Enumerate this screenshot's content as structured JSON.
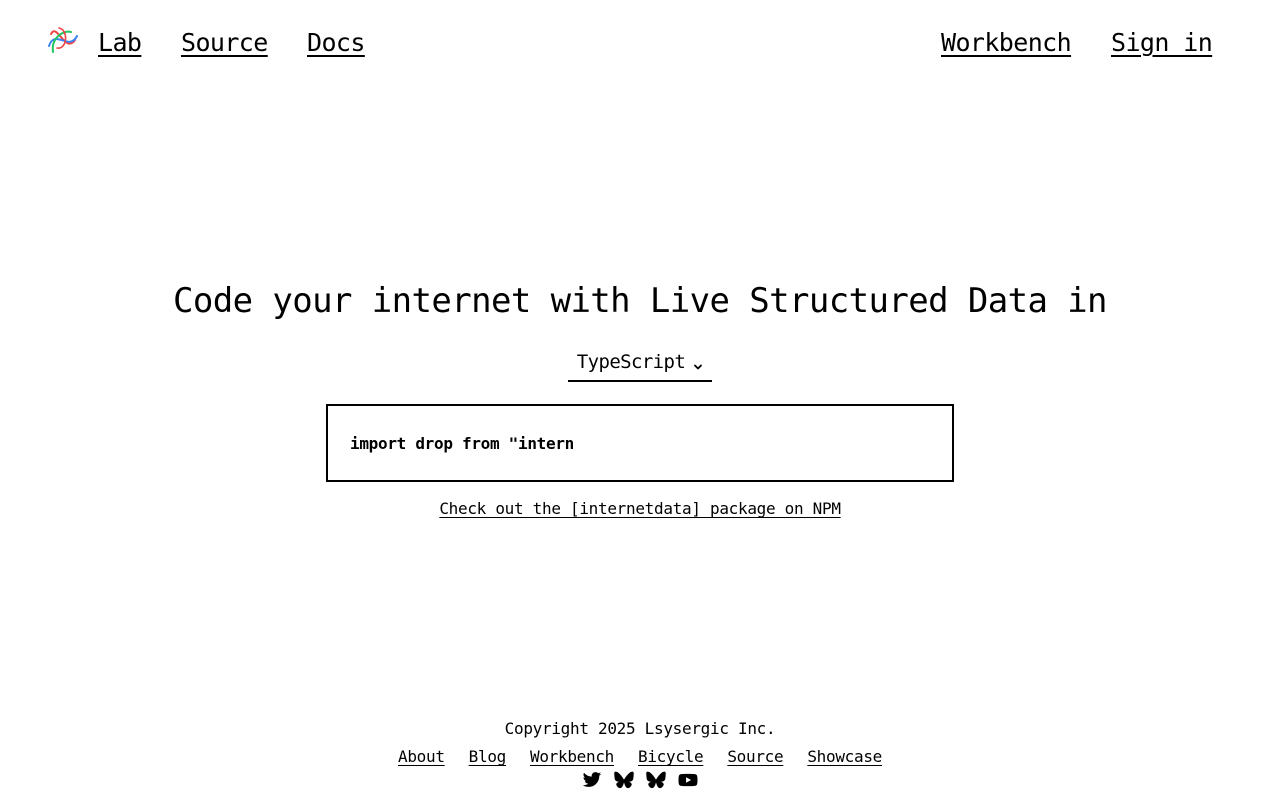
{
  "header": {
    "logo_icon": "tangled-ribbon-logo-icon",
    "nav_left": [
      {
        "label": "Lab"
      },
      {
        "label": "Source"
      },
      {
        "label": "Docs"
      }
    ],
    "nav_right": [
      {
        "label": "Workbench"
      },
      {
        "label": "Sign in"
      }
    ]
  },
  "hero": {
    "title": "Code your internet with Live Structured Data in",
    "language": {
      "selected": "TypeScript",
      "icon": "chevron-down-icon"
    },
    "code": "import drop from \"intern",
    "npm_link": "Check out the [internetdata] package on NPM"
  },
  "footer": {
    "copyright": "Copyright 2025 Lsysergic Inc.",
    "links": [
      {
        "label": "About"
      },
      {
        "label": "Blog"
      },
      {
        "label": "Workbench"
      },
      {
        "label": "Bicycle"
      },
      {
        "label": "Source"
      },
      {
        "label": "Showcase"
      }
    ],
    "socials": [
      "twitter-icon",
      "bluesky-icon",
      "bluesky-icon",
      "youtube-icon"
    ]
  },
  "colors": {
    "text": "#000000",
    "background": "#ffffff",
    "logo_red": "#ef4444",
    "logo_blue": "#3b82f6",
    "logo_green": "#22c55e"
  }
}
